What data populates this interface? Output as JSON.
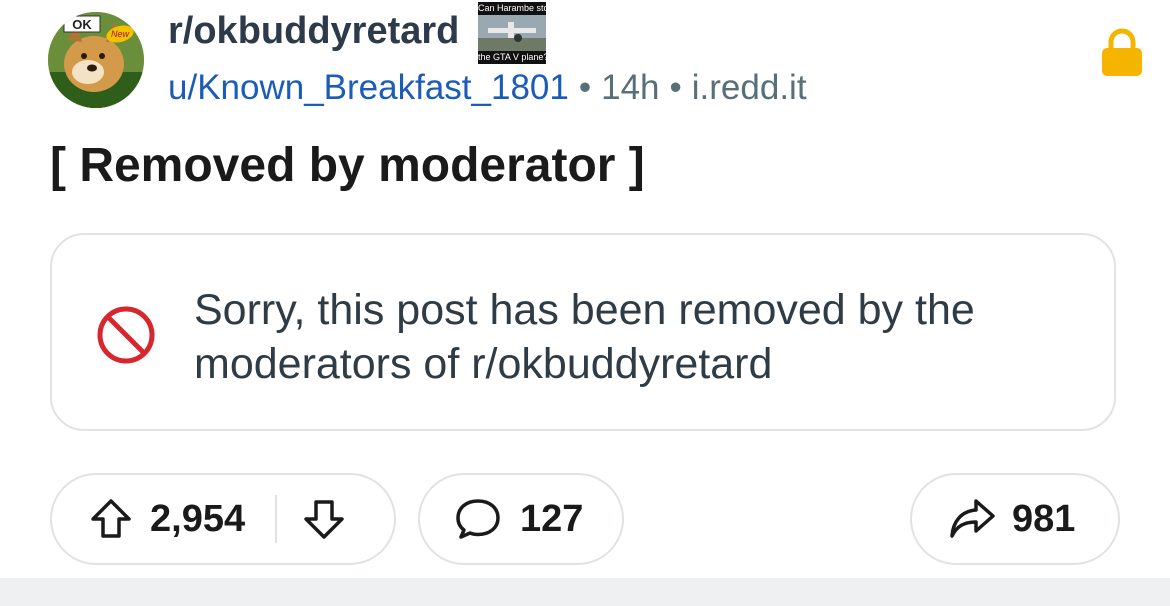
{
  "post": {
    "subreddit": "r/okbuddyretard",
    "author": "u/Known_Breakfast_1801",
    "age": "14h",
    "domain": "i.redd.it",
    "title": "[ Removed by moderator ]",
    "removed_message": "Sorry, this post has been removed by the moderators of r/okbuddyretard"
  },
  "flair": {
    "top_text": "Can Harambe stop",
    "bottom_text": "the GTA V plane?"
  },
  "avatar": {
    "badge_text": "OK",
    "new_text": "New"
  },
  "actions": {
    "upvotes": "2,954",
    "comments": "127",
    "shares": "981"
  },
  "colors": {
    "lock": "#f4b400",
    "removed_icon": "#d6262e",
    "user_link": "#1a5cb8",
    "border": "#dfe3e6"
  },
  "icons": [
    "lock-icon",
    "no-entry-icon",
    "upvote-icon",
    "downvote-icon",
    "comment-icon",
    "share-icon"
  ]
}
